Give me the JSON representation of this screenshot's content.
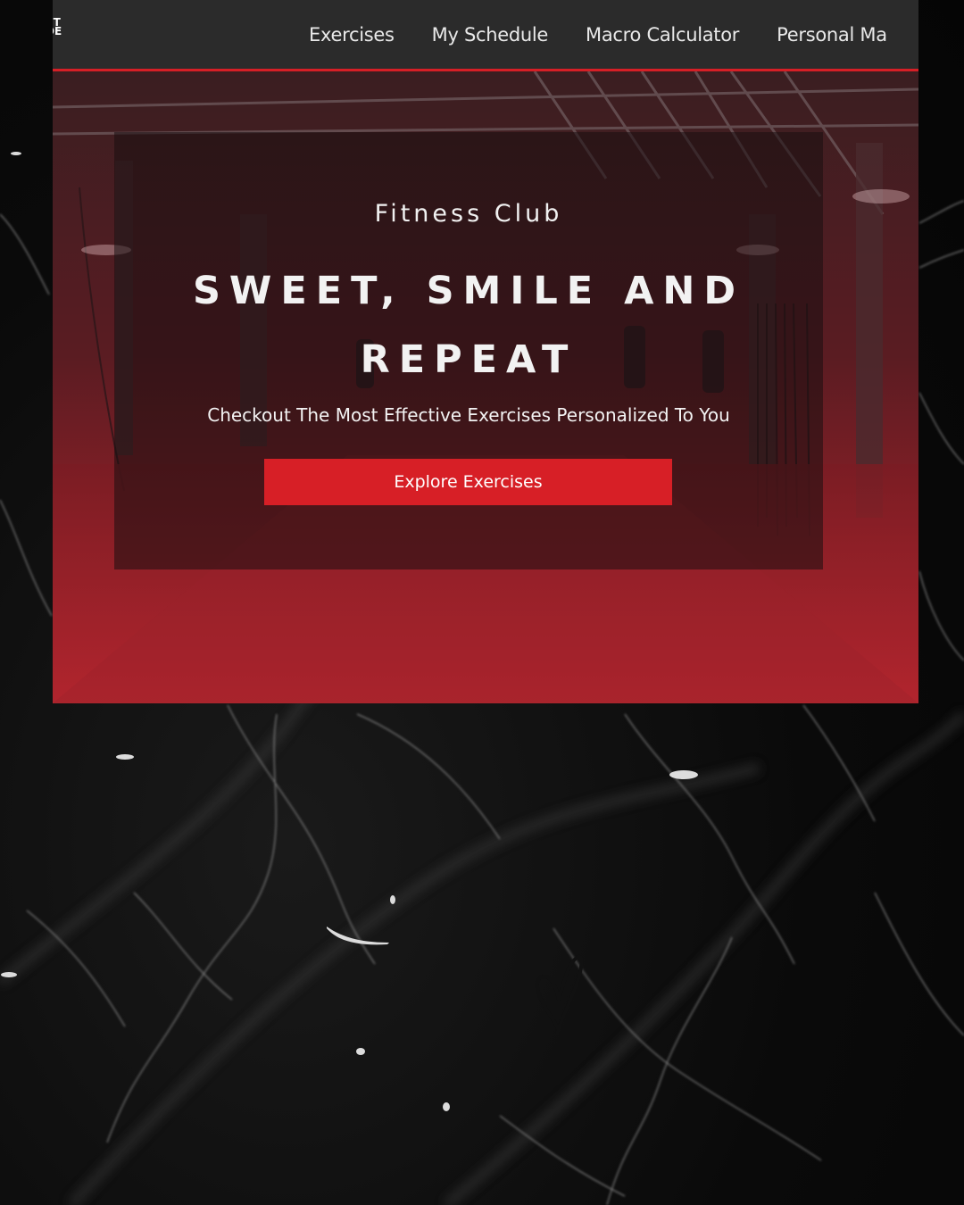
{
  "navbar": {
    "logo_line1": "ST",
    "logo_line2": "DE",
    "links": [
      {
        "label": "Exercises"
      },
      {
        "label": "My Schedule"
      },
      {
        "label": "Macro Calculator"
      },
      {
        "label": "Personal Ma"
      }
    ]
  },
  "hero": {
    "eyebrow": "Fitness Club",
    "headline": "SWEET, SMILE AND REPEAT",
    "subline": "Checkout The Most Effective Exercises Personalized To You",
    "cta_label": "Explore Exercises"
  },
  "colors": {
    "accent": "#d71f26",
    "nav_bg": "#2b2b2b",
    "page_bg": "#0b0b0b"
  },
  "icons": {
    "logo": "brand-logo",
    "heart": "heart-doodle-icon"
  }
}
